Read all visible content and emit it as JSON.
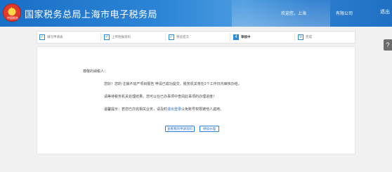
{
  "header": {
    "title": "国家税务总局上海市电子税务局",
    "emblem_text": "中国税务",
    "welcome": "欢迎您，上海",
    "company": "有限公司",
    "logout": "退出"
  },
  "help_icon_glyph": "?",
  "steps": [
    {
      "num": "✓",
      "label": "填写申请表",
      "done": true
    },
    {
      "num": "✓",
      "label": "上传附报资料",
      "done": true
    },
    {
      "num": "✓",
      "label": "预览提交",
      "done": true
    },
    {
      "num": "4",
      "label": "审核中",
      "active": true
    },
    {
      "num": "5",
      "label": "完成"
    }
  ],
  "message": {
    "greeting": "尊敬的纳税人：",
    "line1": "您好！您的 注销不动产项目报告 申请已成功提交，税务机关将在2个工作日内审核办结，",
    "line2": "请等待税务机关处理结果。您可以在已办事项中查阅此事项的办理进度！",
    "line3_prefix": "温馨提示：若您已办完相关业务，请及时",
    "line3_link": "退出登录",
    "line3_suffix": "以免账号权限被他人盗用。"
  },
  "buttons": {
    "view": "查看我的申请资料",
    "continue": "继续办理"
  },
  "colors": {
    "header": "#2b84d6",
    "accent": "#2a8ad8",
    "link": "#2a6fcf"
  }
}
